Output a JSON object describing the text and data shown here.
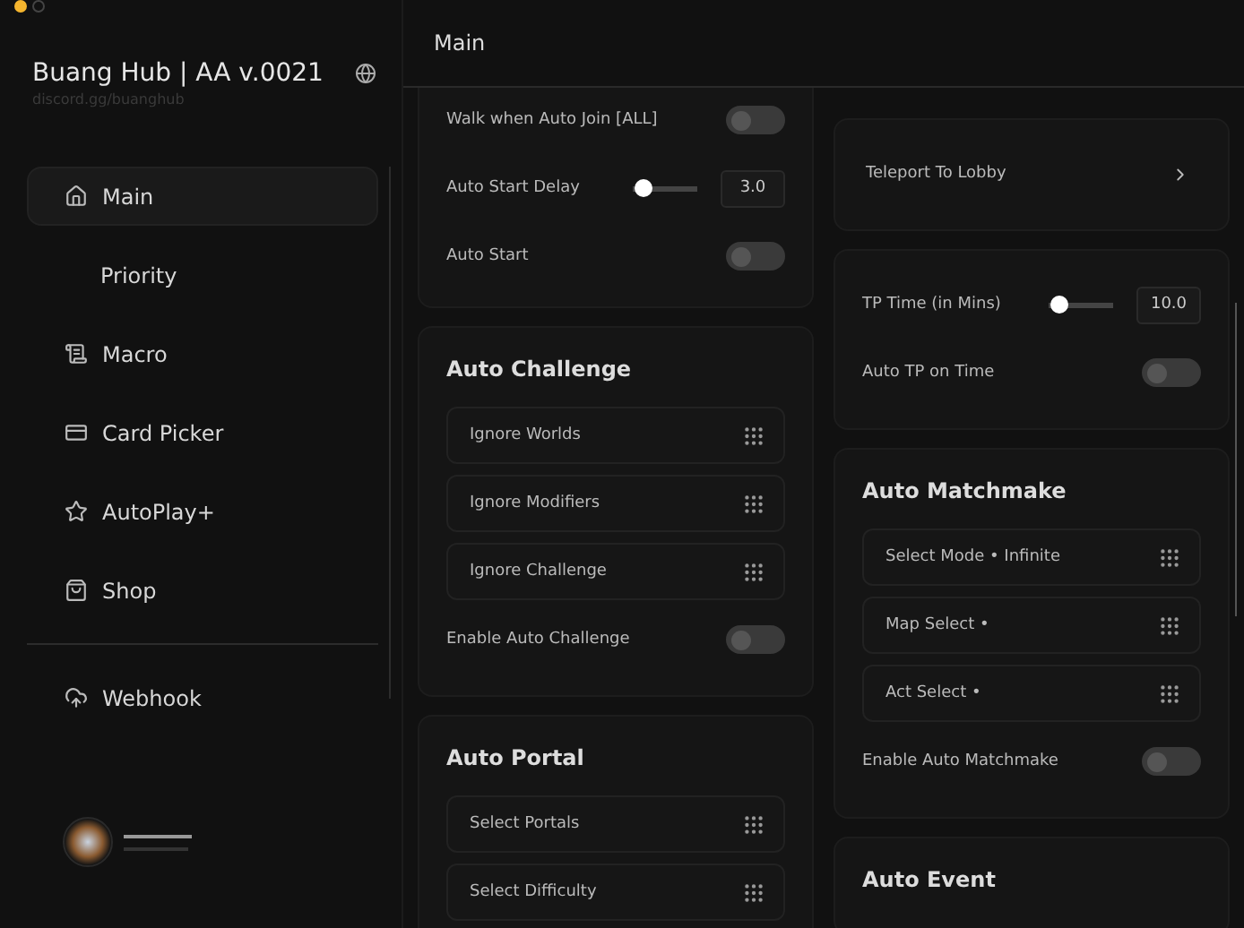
{
  "window": {
    "controls": [
      {
        "kind": "minimize"
      },
      {
        "kind": "inactive"
      }
    ]
  },
  "sidebar": {
    "title": "Buang Hub | AA v.0021",
    "subtitle": "discord.gg/buanghub",
    "items": [
      {
        "label": "Main",
        "selected": true
      },
      {
        "label": "Priority",
        "selected": false
      },
      {
        "label": "Macro",
        "selected": false
      },
      {
        "label": "Card Picker",
        "selected": false
      },
      {
        "label": "AutoPlay+",
        "selected": false
      },
      {
        "label": "Shop",
        "selected": false
      }
    ],
    "footer_items": [
      {
        "label": "Webhook",
        "selected": false
      }
    ]
  },
  "header": {
    "title": "Main"
  },
  "columns": [
    [
      {
        "rows": [
          {
            "kind": "toggle",
            "label": "Walk when Auto Join [ALL]",
            "on": false
          },
          {
            "kind": "slider",
            "label": "Auto Start Delay",
            "level": 0.05,
            "value": "3.0"
          },
          {
            "kind": "toggle",
            "label": "Auto Start",
            "on": false
          }
        ]
      },
      {
        "title": "Auto Challenge",
        "rows": [
          {
            "kind": "dropdown",
            "label": "Ignore Worlds"
          },
          {
            "kind": "dropdown",
            "label": "Ignore Modifiers"
          },
          {
            "kind": "dropdown",
            "label": "Ignore Challenge"
          },
          {
            "kind": "toggle",
            "label": "Enable Auto Challenge",
            "on": false
          }
        ]
      },
      {
        "title": "Auto Portal",
        "rows": [
          {
            "kind": "dropdown",
            "label": "Select Portals"
          },
          {
            "kind": "dropdown",
            "label": "Select Difficulty"
          }
        ]
      }
    ],
    [
      {
        "rows": [
          {
            "kind": "button",
            "label": "Teleport To Lobby"
          }
        ]
      },
      {
        "rows": [
          {
            "kind": "slider",
            "label": "TP Time (in Mins)",
            "level": 0.05,
            "value": "10.0"
          },
          {
            "kind": "toggle",
            "label": "Auto TP on Time",
            "on": false
          }
        ]
      },
      {
        "title": "Auto Matchmake",
        "rows": [
          {
            "kind": "dropdown",
            "label": "Select Mode • Infinite"
          },
          {
            "kind": "dropdown",
            "label": "Map Select •"
          },
          {
            "kind": "dropdown",
            "label": "Act Select •"
          },
          {
            "kind": "toggle",
            "label": "Enable Auto Matchmake",
            "on": false
          }
        ]
      },
      {
        "title": "Auto Event"
      }
    ]
  ]
}
